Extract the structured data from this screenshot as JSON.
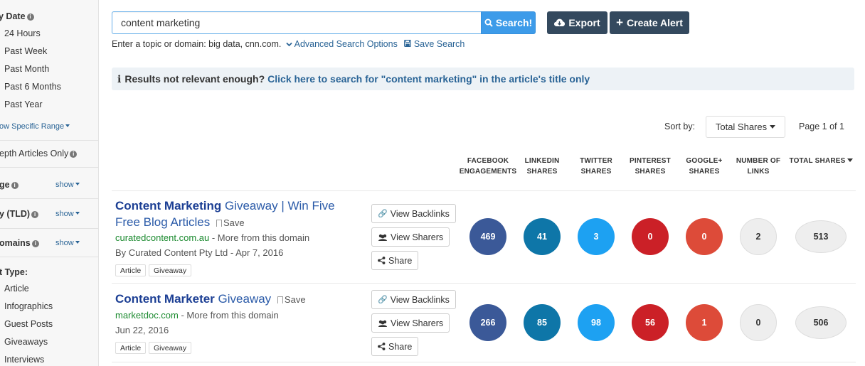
{
  "sidebar": {
    "date_heading": "y Date",
    "date_options": [
      "24 Hours",
      "Past Week",
      "Past Month",
      "Past 6 Months",
      "Past Year"
    ],
    "specific_range": "ow Specific Range",
    "in_depth": "epth Articles Only",
    "filters": [
      {
        "label": "ge",
        "show": "show"
      },
      {
        "label": "y (TLD)",
        "show": "show"
      },
      {
        "label": "omains",
        "show": "show"
      }
    ],
    "content_type_heading": "t Type:",
    "content_types": [
      "Article",
      "Infographics",
      "Guest Posts",
      "Giveaways",
      "Interviews"
    ]
  },
  "search": {
    "value": "content marketing",
    "button_label": "Search!",
    "export_label": "Export",
    "create_alert_label": "Create Alert",
    "hint_text": "Enter a topic or domain: big data, cnn.com.",
    "advanced_label": "Advanced Search Options",
    "save_search_label": "Save Search"
  },
  "notice": {
    "question": "Results not relevant enough?",
    "link": "Click here to search for \"content marketing\" in the article's title only"
  },
  "sort": {
    "label": "Sort by:",
    "selected": "Total Shares",
    "page_info": "Page 1 of 1"
  },
  "columns": {
    "facebook": [
      "FACEBOOK",
      "ENGAGEMENTS"
    ],
    "linkedin": [
      "LINKEDIN",
      "SHARES"
    ],
    "twitter": [
      "TWITTER",
      "SHARES"
    ],
    "pinterest": [
      "PINTEREST",
      "SHARES"
    ],
    "google": [
      "GOOGLE+",
      "SHARES"
    ],
    "links": [
      "NUMBER OF",
      "LINKS"
    ],
    "total": [
      "TOTAL SHARES"
    ]
  },
  "results": [
    {
      "title_bold": "Content Marketing",
      "title_rest": " Giveaway | Win Five Free Blog Articles",
      "save_label": "Save",
      "domain": "curatedcontent.com.au",
      "more": " - More from this domain",
      "meta": "By Curated Content Pty Ltd - Apr 7, 2016",
      "tags": [
        "Article",
        "Giveaway"
      ],
      "buttons": {
        "backlinks": "View Backlinks",
        "sharers": "View Sharers",
        "share": "Share"
      },
      "facebook": "469",
      "linkedin": "41",
      "twitter": "3",
      "pinterest": "0",
      "google": "0",
      "links": "2",
      "total": "513"
    },
    {
      "title_bold": "Content Marketer",
      "title_rest": " Giveaway",
      "save_label": "Save",
      "domain": "marketdoc.com",
      "more": " - More from this domain",
      "meta": "Jun 22, 2016",
      "tags": [
        "Article",
        "Giveaway"
      ],
      "buttons": {
        "backlinks": "View Backlinks",
        "sharers": "View Sharers",
        "share": "Share"
      },
      "facebook": "266",
      "linkedin": "85",
      "twitter": "98",
      "pinterest": "56",
      "google": "1",
      "links": "0",
      "total": "506"
    }
  ],
  "colors": {
    "facebook": "#3b5998",
    "linkedin": "#0e76a8",
    "twitter": "#1da1f2",
    "pinterest": "#cb2027",
    "google": "#dd4b39",
    "accent": "#3d9be9",
    "dark_button": "#34495e"
  }
}
